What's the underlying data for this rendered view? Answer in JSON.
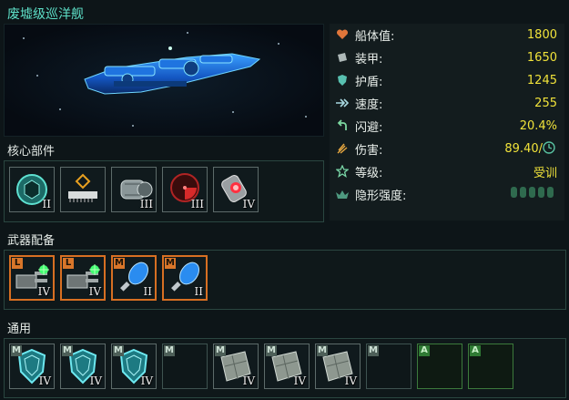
{
  "ship": {
    "name": "废墟级巡洋舰"
  },
  "stats": [
    {
      "icon": "heart-icon",
      "label": "船体值:",
      "value": "1800"
    },
    {
      "icon": "armor-icon",
      "label": "装甲:",
      "value": "1650"
    },
    {
      "icon": "shield-icon",
      "label": "护盾:",
      "value": "1245"
    },
    {
      "icon": "speed-arrows-icon",
      "label": "速度:",
      "value": "255"
    },
    {
      "icon": "evade-arrow-icon",
      "label": "闪避:",
      "value": "20.4%"
    },
    {
      "icon": "damage-icon",
      "label": "伤害:",
      "value": "89.40/"
    },
    {
      "icon": "star-icon",
      "label": "等级:",
      "value": "受训"
    },
    {
      "icon": "stealth-icon",
      "label": "隐形强度:",
      "value": ""
    }
  ],
  "sections": {
    "core": "核心部件",
    "weapons": "武器配备",
    "general": "通用"
  },
  "core_slots": [
    {
      "icon": "reactor-core-icon",
      "tier": "II"
    },
    {
      "icon": "chip-processor-icon",
      "tier": ""
    },
    {
      "icon": "engine-cylinder-icon",
      "tier": "III"
    },
    {
      "icon": "radar-dish-icon",
      "tier": "III"
    },
    {
      "icon": "warp-cell-icon",
      "tier": "IV"
    }
  ],
  "weapon_slots": [
    {
      "tag": "L",
      "icon": "turret-cannon-icon",
      "tier": "IV"
    },
    {
      "tag": "L",
      "icon": "turret-cannon-icon",
      "tier": "IV"
    },
    {
      "tag": "M",
      "icon": "plasma-torch-icon",
      "tier": "II"
    },
    {
      "tag": "M",
      "icon": "plasma-torch-icon",
      "tier": "II"
    }
  ],
  "general_slots": [
    {
      "tag": "M",
      "icon": "shield-module-icon",
      "tier": "IV"
    },
    {
      "tag": "M",
      "icon": "shield-module-icon",
      "tier": "IV"
    },
    {
      "tag": "M",
      "icon": "shield-module-icon",
      "tier": "IV"
    },
    {
      "tag": "M",
      "icon": "empty",
      "tier": ""
    },
    {
      "tag": "M",
      "icon": "armor-plate-icon",
      "tier": "IV"
    },
    {
      "tag": "M",
      "icon": "armor-plate-icon",
      "tier": "IV"
    },
    {
      "tag": "M",
      "icon": "armor-plate-icon",
      "tier": "IV"
    },
    {
      "tag": "M",
      "icon": "empty",
      "tier": ""
    },
    {
      "tag": "A",
      "icon": "empty",
      "tier": ""
    },
    {
      "tag": "A",
      "icon": "empty",
      "tier": ""
    }
  ],
  "colors": {
    "accent_title": "#5ee0c8",
    "value_yellow": "#f0e23a",
    "slot_orange": "#d76f22",
    "slot_green": "#3c7a3c"
  }
}
